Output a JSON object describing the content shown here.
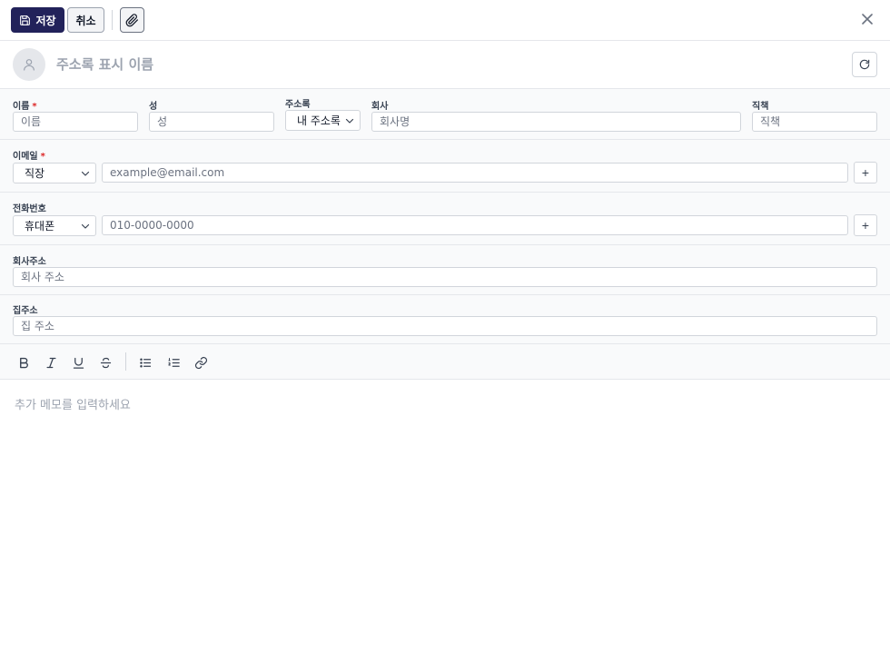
{
  "toolbar": {
    "save_label": "저장",
    "cancel_label": "취소",
    "save_icon": "save-icon",
    "attach_icon": "paperclip-icon",
    "close_icon": "close-icon"
  },
  "header": {
    "display_name_placeholder": "주소록 표시 이름",
    "avatar_icon": "user-icon",
    "refresh_icon": "refresh-icon"
  },
  "form": {
    "first_name": {
      "label": "이름",
      "required_mark": "*",
      "placeholder": "이름"
    },
    "last_name": {
      "label": "성",
      "placeholder": "성"
    },
    "address_book": {
      "label": "주소록",
      "selected": "내 주소록"
    },
    "company": {
      "label": "회사",
      "placeholder": "회사명"
    },
    "job_title": {
      "label": "직책",
      "placeholder": "직책"
    },
    "email": {
      "label": "이메일",
      "required_mark": "*",
      "type_selected": "직장",
      "placeholder": "example@email.com",
      "add_label": "+"
    },
    "phone": {
      "label": "전화번호",
      "type_selected": "휴대폰",
      "placeholder": "010-0000-0000",
      "add_label": "+"
    },
    "work_address": {
      "label": "회사주소",
      "placeholder": "회사 주소"
    },
    "home_address": {
      "label": "집주소",
      "placeholder": "집 주소"
    }
  },
  "editor": {
    "tools": [
      "bold-icon",
      "italic-icon",
      "underline-icon",
      "strikethrough-icon",
      "bullet-list-icon",
      "numbered-list-icon",
      "link-icon"
    ],
    "memo_placeholder": "추가 메모를 입력하세요"
  },
  "colors": {
    "primary": "#22225a",
    "required": "#dc2626",
    "border": "#d1d5db",
    "section_bg": "#f9fafb"
  }
}
